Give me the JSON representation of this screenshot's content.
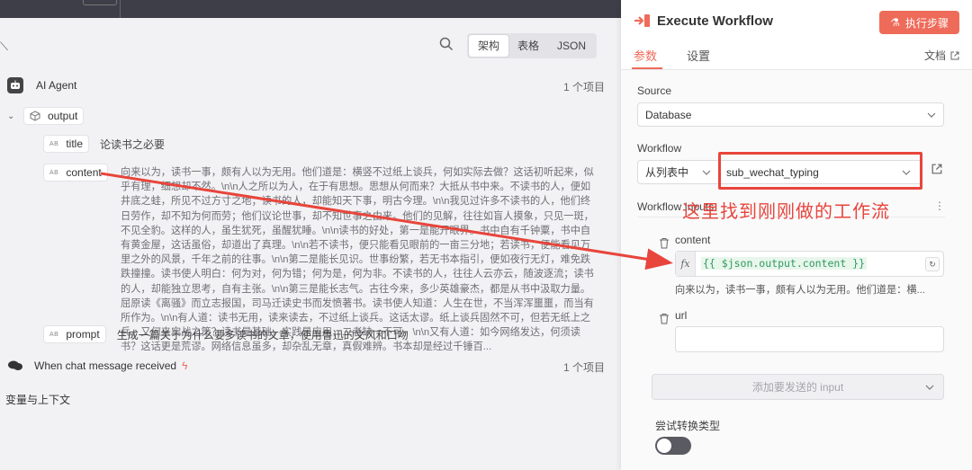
{
  "left_panel": {
    "view_tabs": [
      "架构",
      "表格",
      "JSON"
    ],
    "ai_agent": {
      "label": "AI Agent",
      "count": "1 个项目"
    },
    "output": {
      "label": "output"
    },
    "fields": {
      "title": {
        "name": "title",
        "value": "论读书之必要"
      },
      "content": {
        "name": "content",
        "value": "向来以为，读书一事，颇有人以为无用。他们道是：横竖不过纸上谈兵，何如实际去做？这话初听起来，似乎有理，细想却不然。\\n\\n人之所以为人，在于有思想。思想从何而来？大抵从书中来。不读书的人，便如井底之蛙，所见不过方寸之地；读书的人，却能知天下事，明古今理。\\n\\n我见过许多不读书的人，他们终日劳作，却不知为何而劳；他们议论世事，却不知世事之由来。他们的见解，往往如盲人摸象，只见一斑，不见全豹。这样的人，虽生犹死，虽醒犹睡。\\n\\n读书的好处，第一是能开眼界。书中自有千钟粟，书中自有黄金屋，这话虽俗，却道出了真理。\\n\\n若不读书，便只能看见眼前的一亩三分地；若读书，便能看见万里之外的风景，千年之前的往事。\\n\\n第二是能长见识。世事纷繁，若无书本指引，便如夜行无灯，难免跌跌撞撞。读书使人明白：何为对，何为错；何为是，何为非。不读书的人，往往人云亦云，随波逐流；读书的人，却能独立思考，自有主张。\\n\\n第三是能长志气。古往今来，多少英雄豪杰，都是从书中汲取力量。屈原读《离骚》而立志报国，司马迁读史书而发愤著书。读书使人知道：人生在世，不当浑浑噩噩，而当有所作为。\\n\\n有人道：读书无用，读来读去，不过纸上谈兵。这话太谬。纸上谈兵固然不可，但若无纸上之兵，又何来实战之策？读书是基础，实践是应用，二者缺一不可。\\n\\n又有人道：如今网络发达，何须读书？这话更是荒谬。网络信息虽多，却杂乱无章，真假难辨。书本却是经过千锤百..."
      },
      "prompt": {
        "name": "prompt",
        "value": "生成一篇关于为什么要多读书的文章，使用鲁迅的文风和口吻"
      }
    },
    "chat_trigger": {
      "label": "When chat message received",
      "count": "1 个项目"
    },
    "section_footer": "变量与上下文"
  },
  "right_panel": {
    "title": "Execute Workflow",
    "exec_button": "执行步骤",
    "tabs": {
      "params": "参数",
      "settings": "设置",
      "docs": "文档"
    },
    "source": {
      "label": "Source",
      "value": "Database"
    },
    "workflow": {
      "label": "Workflow",
      "mode": "从列表中",
      "value": "sub_wechat_typing"
    },
    "workflow_inputs_label": "Workflow Inputs",
    "content_field": {
      "label": "content",
      "expression": "{{ $json.output.content }}",
      "fx": "fx",
      "preview": "向来以为，读书一事，颇有人以为无用。他们道是：横..."
    },
    "url_field": {
      "label": "url",
      "value": ""
    },
    "add_input_placeholder": "添加要发送的 input",
    "try_convert_label": "尝试转换类型"
  },
  "annotation": "这里找到刚刚做的工作流",
  "colors": {
    "accent": "#ee6b5a",
    "annotation_red": "#e8453c",
    "expression_green": "#2f9b5e"
  }
}
